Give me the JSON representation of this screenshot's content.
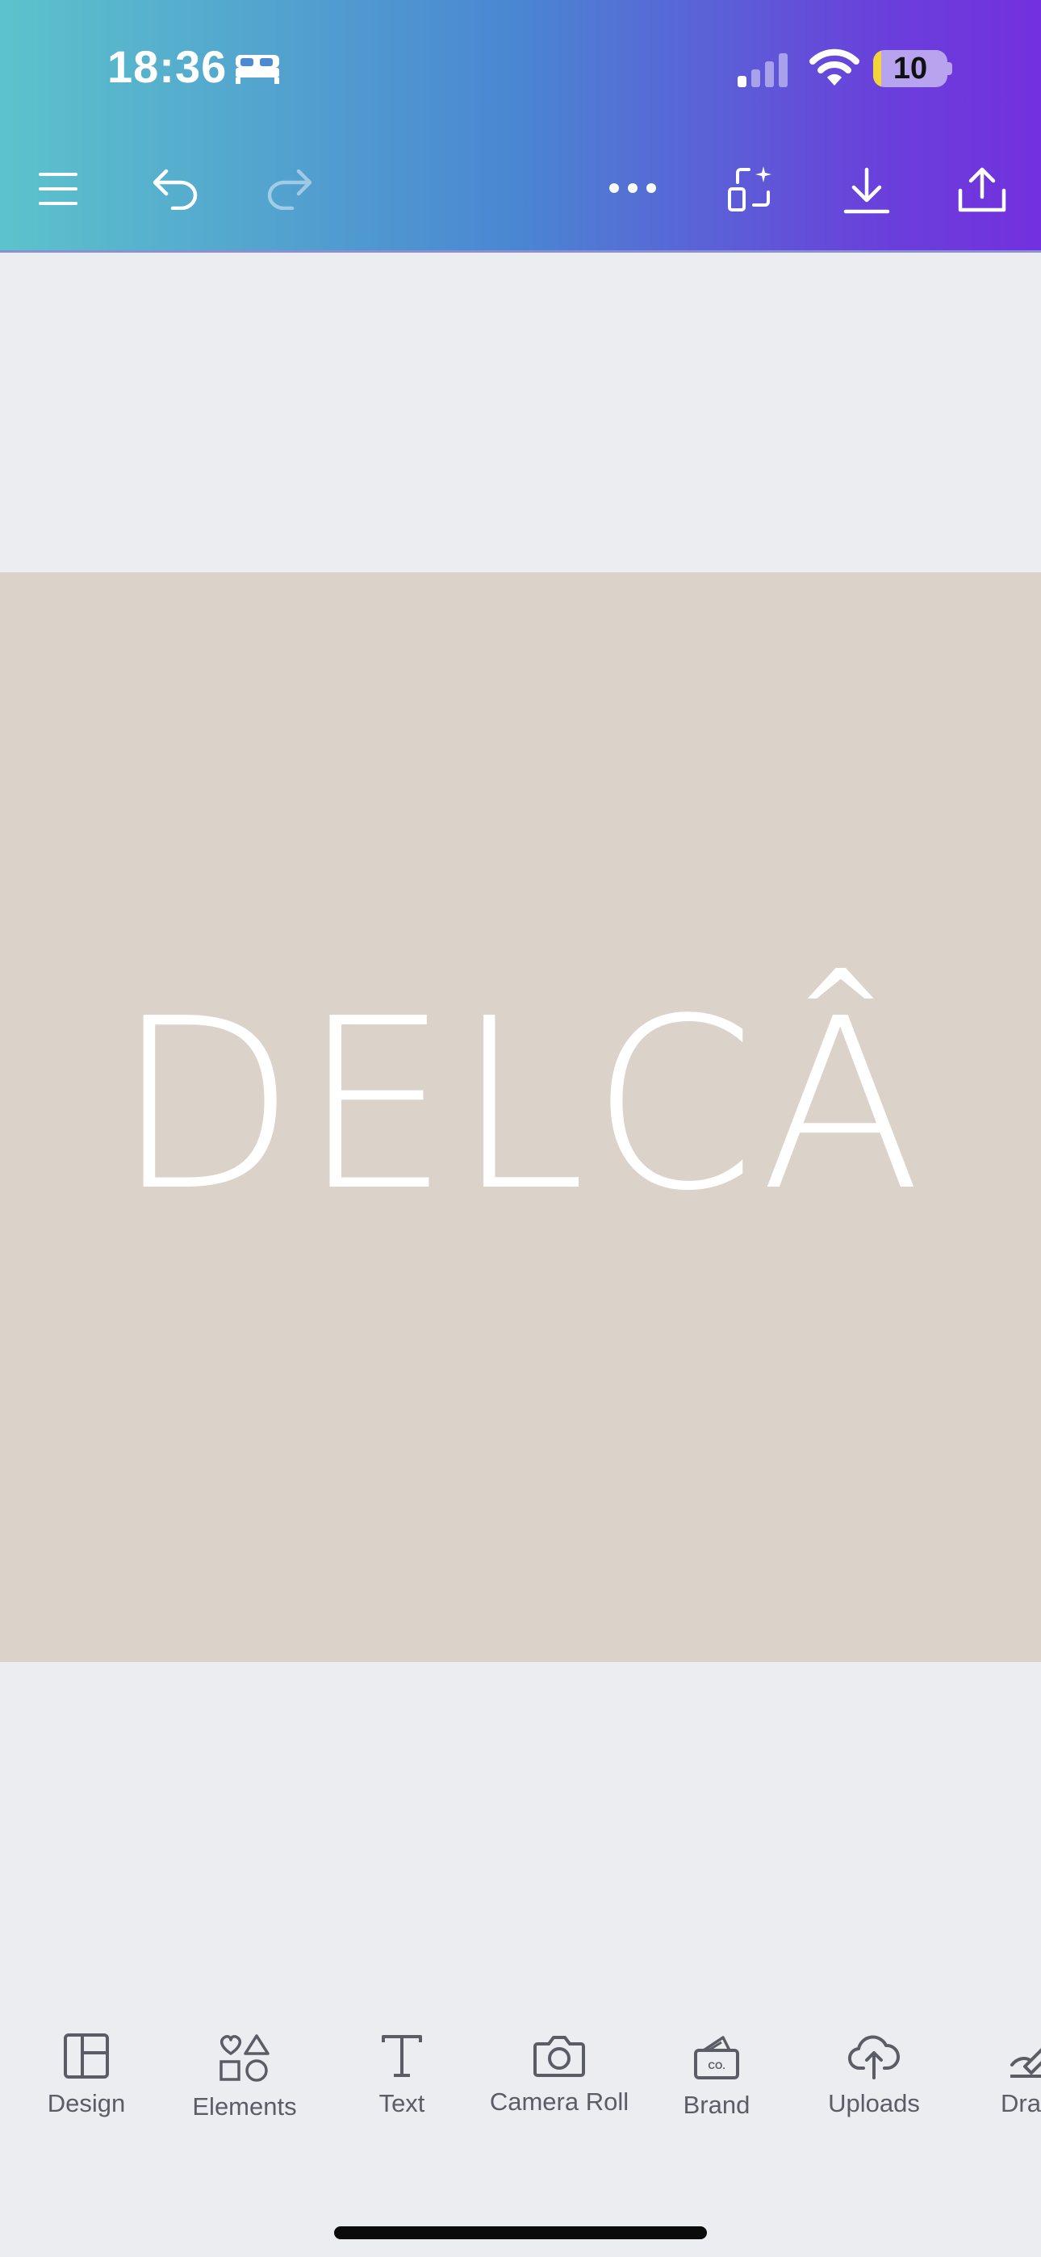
{
  "status_bar": {
    "time": "18:36",
    "battery_level": "10",
    "icons": [
      "bed-icon",
      "signal-icon",
      "wifi-icon",
      "battery-icon"
    ]
  },
  "toolbar": {
    "icons": [
      "menu-icon",
      "undo-icon",
      "redo-icon",
      "more-icon",
      "magic-resize-icon",
      "download-icon",
      "share-icon"
    ]
  },
  "canvas": {
    "text": "DELCÂ",
    "background_color": "#DBD2CA",
    "text_color": "#FFFFFF"
  },
  "bottom_nav": {
    "items": [
      {
        "label": "Design",
        "icon": "design-icon"
      },
      {
        "label": "Elements",
        "icon": "elements-icon"
      },
      {
        "label": "Text",
        "icon": "text-icon"
      },
      {
        "label": "Camera Roll",
        "icon": "camera-icon"
      },
      {
        "label": "Brand",
        "icon": "brand-icon"
      },
      {
        "label": "Uploads",
        "icon": "uploads-icon"
      },
      {
        "label": "Dra",
        "icon": "draw-icon"
      }
    ]
  },
  "colors": {
    "header_gradient_start": "#5CC3CB",
    "header_gradient_end": "#7330DE",
    "app_background": "#ECEDF1",
    "nav_text": "#5B5D66"
  }
}
